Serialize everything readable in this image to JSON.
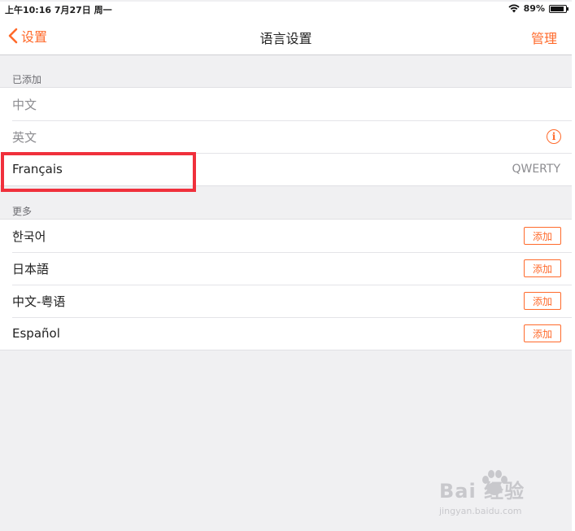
{
  "status": {
    "time_date": "上午10:16   7月27日 周一",
    "battery_text": "89%",
    "battery_level": 0.89
  },
  "nav": {
    "back_label": "设置",
    "title": "语言设置",
    "manage_label": "管理"
  },
  "added_section": {
    "header": "已添加",
    "rows": [
      {
        "label": "中文",
        "detail": ""
      },
      {
        "label": "英文",
        "detail": ""
      },
      {
        "label": "Français",
        "detail": "QWERTY"
      }
    ]
  },
  "more_section": {
    "header": "更多",
    "rows": [
      {
        "label": "한국어",
        "button": "添加"
      },
      {
        "label": "日本語",
        "button": "添加"
      },
      {
        "label": "中文-粤语",
        "button": "添加"
      },
      {
        "label": "Español",
        "button": "添加"
      }
    ]
  },
  "watermark": {
    "logo_text": "Bai  经验",
    "sub_text": "jingyan.baidu.com"
  },
  "colors": {
    "accent": "#ff6a2b",
    "highlight": "#f0303c",
    "background": "#f0f0f2"
  }
}
